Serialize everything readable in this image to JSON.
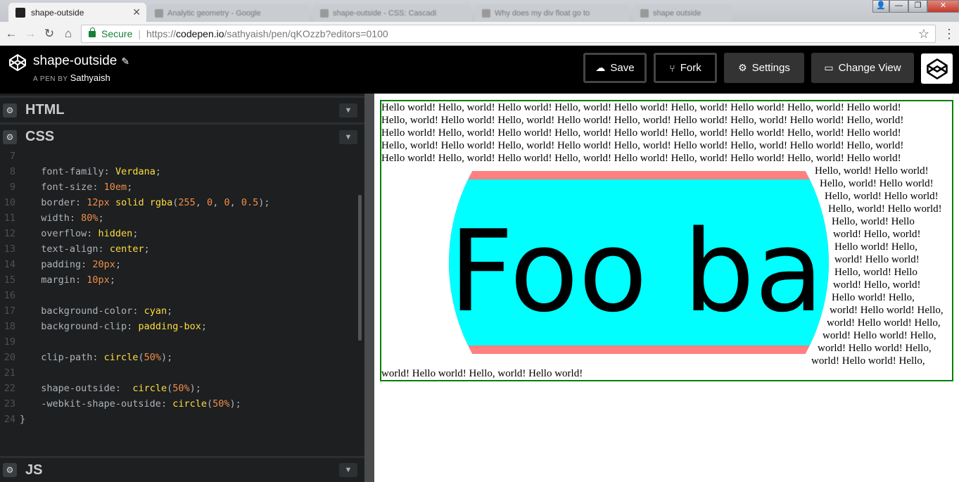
{
  "browser": {
    "active_tab": "shape-outside",
    "ghost_tabs": [
      "Analytic geometry - Google",
      "shape-outside - CSS: Cascadi",
      "Why does my div float go to",
      "shape outside"
    ],
    "secure_label": "Secure",
    "url_prefix": "https://",
    "url_domain": "codepen.io",
    "url_path": "/sathyaish/pen/qKOzzb?editors=0100"
  },
  "codepen": {
    "pen_title": "shape-outside",
    "a_pen_by": "A PEN BY",
    "author": "Sathyaish",
    "buttons": {
      "save": "Save",
      "fork": "Fork",
      "settings": "Settings",
      "change_view": "Change View"
    }
  },
  "panes": {
    "html": "HTML",
    "css": "CSS",
    "js": "JS"
  },
  "css_code": [
    {
      "n": "7",
      "prop": "",
      "val": "",
      "rest": ""
    },
    {
      "n": "8",
      "prop": "font-family",
      "val": "Verdana",
      "rest": ";"
    },
    {
      "n": "9",
      "prop": "font-size",
      "num": "10em",
      "rest": ";"
    },
    {
      "n": "10",
      "prop": "border",
      "raw": true
    },
    {
      "n": "11",
      "prop": "width",
      "num": "80%",
      "rest": ";"
    },
    {
      "n": "12",
      "prop": "overflow",
      "val": "hidden",
      "rest": ";"
    },
    {
      "n": "13",
      "prop": "text-align",
      "val": "center",
      "rest": ";"
    },
    {
      "n": "14",
      "prop": "padding",
      "num": "20px",
      "rest": ";"
    },
    {
      "n": "15",
      "prop": "margin",
      "num": "10px",
      "rest": ";"
    },
    {
      "n": "16"
    },
    {
      "n": "17",
      "prop": "background-color",
      "val": "cyan",
      "rest": ";"
    },
    {
      "n": "18",
      "prop": "background-clip",
      "val": "padding-box",
      "rest": ";"
    },
    {
      "n": "19"
    },
    {
      "n": "20",
      "prop": "clip-path",
      "fn": "circle",
      "num": "50%"
    },
    {
      "n": "21"
    },
    {
      "n": "22",
      "prop": "shape-outside",
      "fn": "circle",
      "num": "50%"
    },
    {
      "n": "23",
      "prop": "-webkit-shape-outside",
      "fn": "circle",
      "num": "50%"
    },
    {
      "n": "24",
      "close": "}"
    }
  ],
  "border_line": {
    "prop": "border",
    "num1": "12px",
    "val1": "solid",
    "fn": "rgba",
    "args": [
      "255",
      "0",
      "0",
      "0.5"
    ]
  },
  "preview": {
    "foo_text": "Foo bar",
    "lines": [
      "Hello world! Hello, world! Hello world! Hello, world! Hello world! Hello, world! Hello world! Hello, world! Hello world!",
      "Hello, world! Hello world! Hello, world! Hello world! Hello, world! Hello world! Hello, world! Hello world! Hello, world!",
      "Hello world! Hello, world! Hello world! Hello, world! Hello world! Hello, world! Hello world! Hello, world! Hello world!",
      "Hello, world! Hello world! Hello, world! Hello world! Hello, world! Hello world! Hello, world! Hello world! Hello, world!",
      "Hello world! Hello, world! Hello world! Hello, world! Hello world! Hello, world! Hello world! Hello, world! Hello world!",
      "Hello, world! Hello world!",
      "Hello, world! Hello world!",
      "Hello, world! Hello world!",
      "Hello, world! Hello world!",
      "Hello, world! Hello",
      "world! Hello, world!",
      "Hello world! Hello,",
      "world! Hello world!",
      "Hello, world! Hello",
      "world! Hello, world!",
      "Hello world! Hello,",
      "world! Hello world! Hello,",
      "world! Hello world! Hello,",
      "world! Hello world! Hello,",
      "world! Hello world! Hello,",
      "world! Hello world! Hello,",
      "world! Hello world! Hello, world! Hello world!"
    ]
  }
}
